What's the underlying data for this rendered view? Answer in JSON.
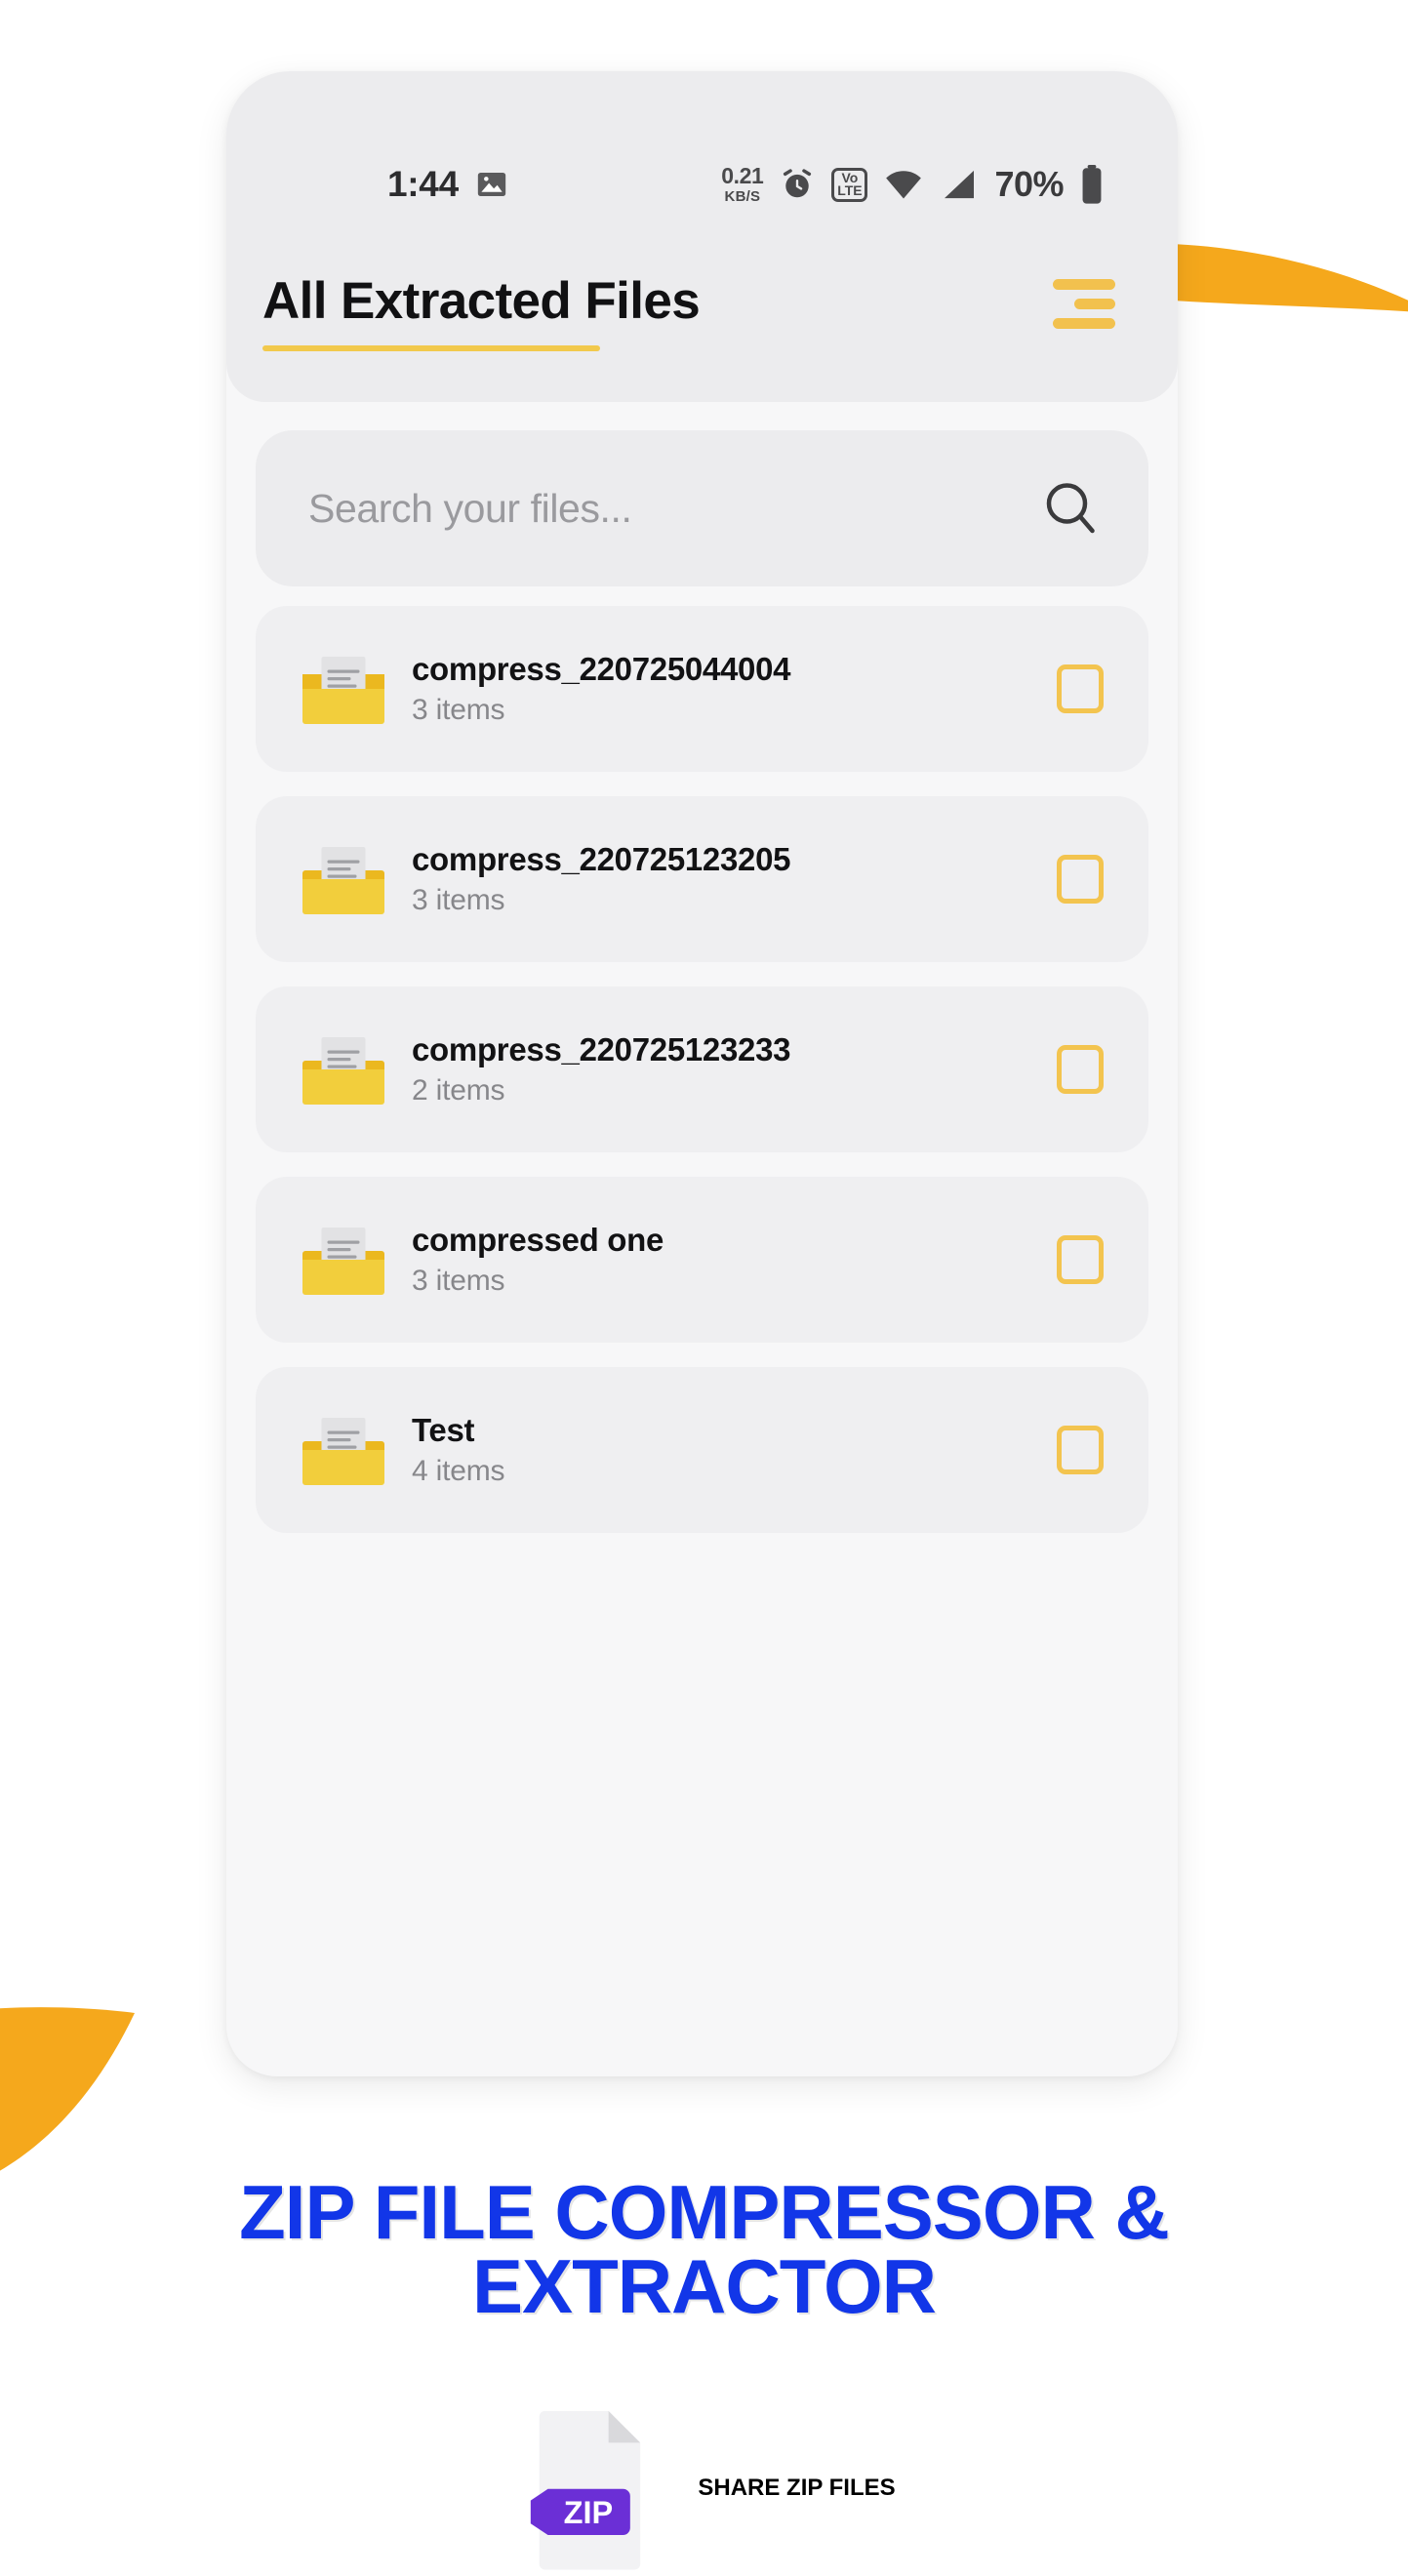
{
  "colors": {
    "accent_yellow": "#F2C14E",
    "accent_orange": "#F5A81C",
    "banner_blue": "#1236E8",
    "zip_purple": "#6B2FD6",
    "phone_bg": "#F7F7F8",
    "card_bg": "#ECECEE",
    "row_bg": "#EFEFF1"
  },
  "status_bar": {
    "time": "1:44",
    "photo_icon": "image-icon",
    "data_rate_value": "0.21",
    "data_rate_unit": "KB/S",
    "alarm_icon": "alarm-clock-icon",
    "volte_top": "Vo",
    "volte_bottom": "LTE",
    "wifi_icon": "wifi-icon",
    "signal_icon": "cellular-signal-icon",
    "battery_percent": "70%",
    "battery_icon": "battery-icon"
  },
  "header": {
    "title": "All Extracted Files",
    "menu_icon": "hamburger-menu-icon"
  },
  "search": {
    "placeholder": "Search your files...",
    "icon": "search-icon"
  },
  "files": [
    {
      "name": "compress_220725044004",
      "items": "3 items",
      "icon": "folder-document-icon",
      "checked": false
    },
    {
      "name": "compress_220725123205",
      "items": "3 items",
      "icon": "folder-document-icon",
      "checked": false
    },
    {
      "name": "compress_220725123233",
      "items": "2 items",
      "icon": "folder-document-icon",
      "checked": false
    },
    {
      "name": "compressed one",
      "items": "3 items",
      "icon": "folder-document-icon",
      "checked": false
    },
    {
      "name": "Test",
      "items": "4 items",
      "icon": "folder-document-icon",
      "checked": false
    }
  ],
  "banner": {
    "headline": "ZIP FILE COMPRESSOR & EXTRACTOR",
    "subline": "SHARE ZIP FILES",
    "zip_badge_label": "ZIP",
    "zip_icon": "zip-document-icon"
  }
}
